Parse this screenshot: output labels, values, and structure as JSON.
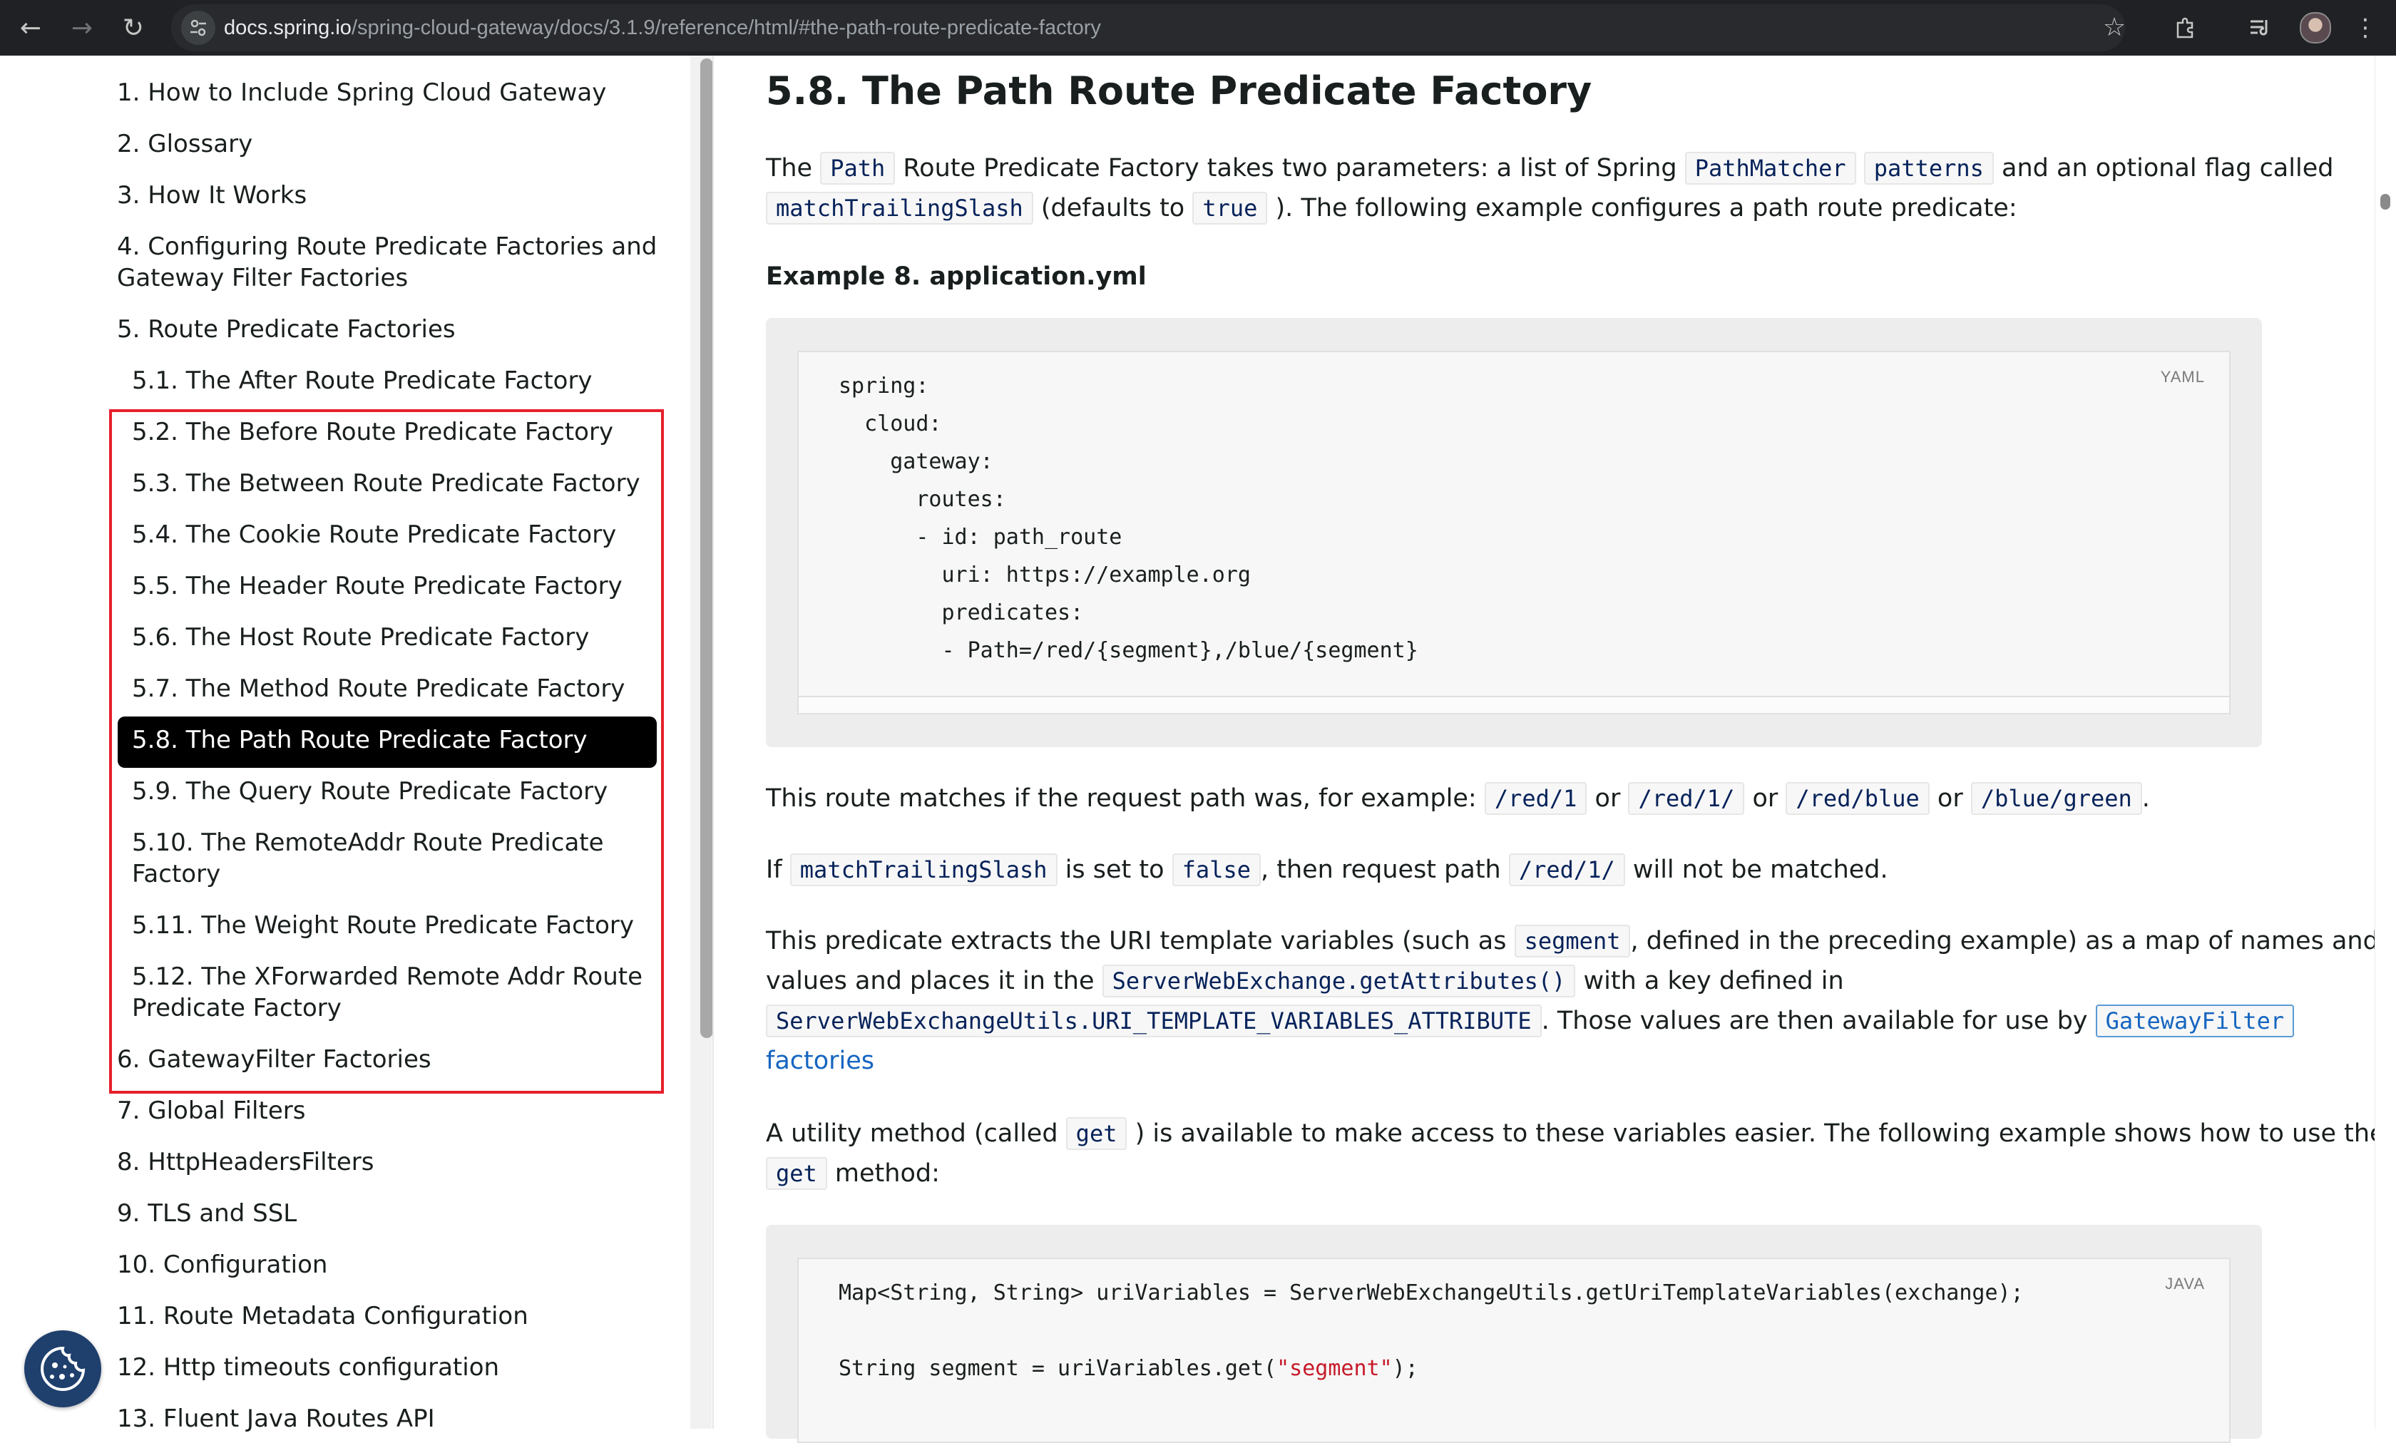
{
  "browser": {
    "url_host": "docs.spring.io",
    "url_path": "/spring-cloud-gateway/docs/3.1.9/reference/html/#the-path-route-predicate-factory"
  },
  "sidebar": {
    "items": [
      {
        "label": "1. How to Include Spring Cloud Gateway"
      },
      {
        "label": "2. Glossary"
      },
      {
        "label": "3. How It Works"
      },
      {
        "label_line1": "4. Configuring Route Predicate Factories and",
        "label_line2": "Gateway Filter Factories"
      },
      {
        "label": "5. Route Predicate Factories"
      },
      {
        "label": "6. GatewayFilter Factories"
      },
      {
        "label": "7. Global Filters"
      },
      {
        "label": "8. HttpHeadersFilters"
      },
      {
        "label": "9. TLS and SSL"
      },
      {
        "label": "10. Configuration"
      },
      {
        "label": "11. Route Metadata Configuration"
      },
      {
        "label": "12. Http timeouts configuration"
      },
      {
        "label": "13. Fluent Java Routes API"
      }
    ],
    "subitems": [
      {
        "label": "5.1. The After Route Predicate Factory"
      },
      {
        "label": "5.2. The Before Route Predicate Factory"
      },
      {
        "label": "5.3. The Between Route Predicate Factory"
      },
      {
        "label": "5.4. The Cookie Route Predicate Factory"
      },
      {
        "label": "5.5. The Header Route Predicate Factory"
      },
      {
        "label": "5.6. The Host Route Predicate Factory"
      },
      {
        "label": "5.7. The Method Route Predicate Factory"
      },
      {
        "label": "5.8. The Path Route Predicate Factory"
      },
      {
        "label": "5.9. The Query Route Predicate Factory"
      },
      {
        "label_line1": "5.10. The RemoteAddr Route Predicate",
        "label_line2": "Factory"
      },
      {
        "label": "5.11. The Weight Route Predicate Factory"
      },
      {
        "label_line1": "5.12. The XForwarded Remote Addr Route",
        "label_line2": "Predicate Factory"
      }
    ]
  },
  "main": {
    "heading": "5.8. The Path Route Predicate Factory",
    "p1": {
      "t1": "The ",
      "c1": "Path",
      "t2": " Route Predicate Factory takes two parameters: a list of Spring ",
      "c2": "PathMatcher",
      "c3": "patterns",
      "t3": " and an optional flag called",
      "c4": "matchTrailingSlash",
      "t4": " (defaults to ",
      "c5": "true",
      "t5": " ). The following example configures a path route predicate:"
    },
    "example_title": "Example 8. application.yml",
    "yaml": {
      "lang": "YAML",
      "lines": [
        "spring:",
        "  cloud:",
        "    gateway:",
        "      routes:",
        "      - id: path_route",
        "        uri: https://example.org",
        "        predicates:",
        "        - Path=/red/{segment},/blue/{segment}"
      ]
    },
    "p2": {
      "t1": "This route matches if the request path was, for example: ",
      "c1": "/red/1",
      "t2": " or ",
      "c2": "/red/1/",
      "t3": " or ",
      "c3": "/red/blue",
      "t4": " or ",
      "c4": "/blue/green",
      "t5": "."
    },
    "p3": {
      "t1": "If ",
      "c1": "matchTrailingSlash",
      "t2": " is set to ",
      "c2": "false",
      "t3": ", then request path ",
      "c3": "/red/1/",
      "t4": " will not be matched."
    },
    "p4": {
      "t1": "This predicate extracts the URI template variables (such as ",
      "c1": "segment",
      "t2": ", defined in the preceding example) as a map of names and",
      "t3": "values and places it in the ",
      "c2": "ServerWebExchange.getAttributes()",
      "t4": " with a key defined in",
      "c3": "ServerWebExchangeUtils.URI_TEMPLATE_VARIABLES_ATTRIBUTE",
      "t5": ". Those values are then available for use by ",
      "link_code": "GatewayFilter",
      "link_text": "factories"
    },
    "p5": {
      "t1": "A utility method (called ",
      "c1": "get",
      "t2": " ) is available to make access to these variables easier. The following example shows how to use the",
      "c2": "get",
      "t3": " method:"
    },
    "java": {
      "lang": "JAVA",
      "line1": "Map<String, String> uriVariables = ServerWebExchangeUtils.getUriTemplateVariables(exchange);",
      "line2_a": "String segment = uriVariables.get(",
      "line2_str": "\"segment\"",
      "line2_b": ");"
    }
  }
}
